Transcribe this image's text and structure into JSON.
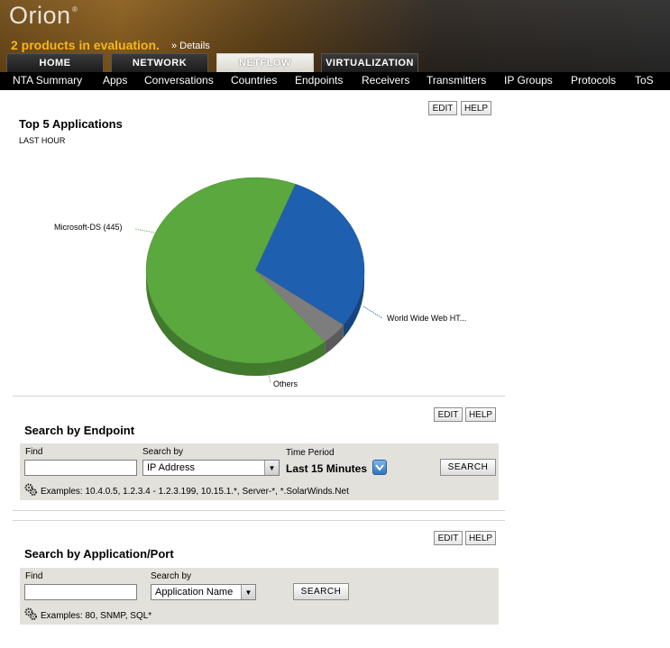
{
  "header": {
    "logo": "Orion",
    "logo_mark": "®",
    "eval_text": "2 products in evaluation.",
    "details_link": "» Details"
  },
  "tabs": [
    "HOME",
    "NETWORK",
    "NETFLOW",
    "VIRTUALIZATION"
  ],
  "active_tab": "NETFLOW",
  "subnav": [
    "NTA Summary",
    "Apps",
    "Conversations",
    "Countries",
    "Endpoints",
    "Receivers",
    "Transmitters",
    "IP Groups",
    "Protocols",
    "ToS"
  ],
  "buttons": {
    "edit": "EDIT",
    "help": "HELP",
    "search": "SEARCH"
  },
  "top_apps": {
    "title": "Top 5 Applications",
    "subtitle": "LAST HOUR",
    "chart_data": {
      "type": "pie",
      "slices": [
        {
          "label": "Microsoft-DS (445)",
          "value": 67,
          "color": "#5aa83e"
        },
        {
          "label": "World Wide Web HT...",
          "value": 29,
          "color": "#1f5fb0"
        },
        {
          "label": "Others",
          "value": 4,
          "color": "#7d7d7d"
        }
      ]
    }
  },
  "endpoint_search": {
    "title": "Search by Endpoint",
    "find_label": "Find",
    "find_value": "",
    "search_by_label": "Search by",
    "search_by_value": "IP Address",
    "time_period_label": "Time Period",
    "time_period_value": "Last 15 Minutes",
    "examples": "Examples:  10.4.0.5,  1.2.3.4 - 1.2.3.199,  10.15.1.*,  Server-*,  *.SolarWinds.Net"
  },
  "app_search": {
    "title": "Search by Application/Port",
    "find_label": "Find",
    "find_value": "",
    "search_by_label": "Search by",
    "search_by_value": "Application Name",
    "examples": "Examples: 80,  SNMP,  SQL*"
  }
}
